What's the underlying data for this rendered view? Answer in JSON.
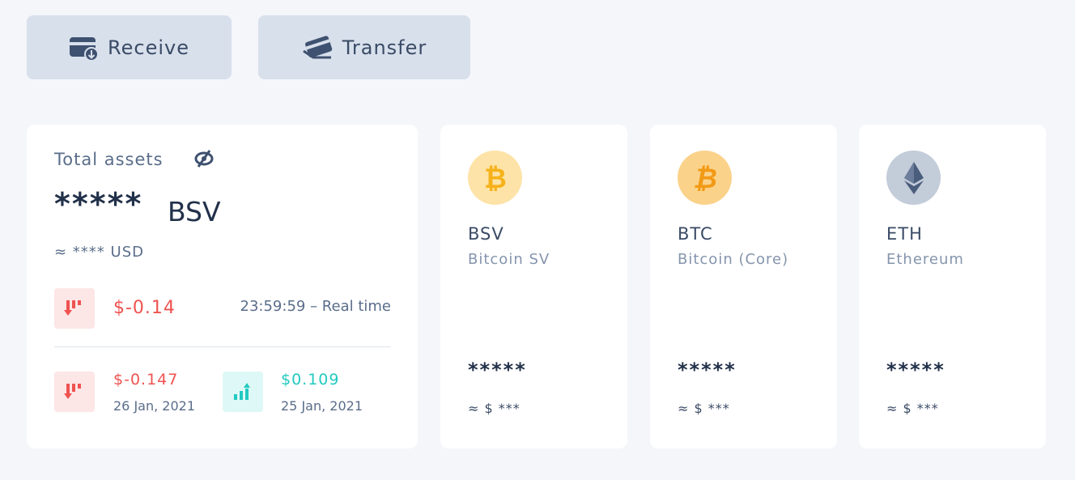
{
  "actions": {
    "receive_label": "Receive",
    "receive_icon": "wallet-receive-icon",
    "transfer_label": "Transfer",
    "transfer_icon": "card-transfer-icon"
  },
  "total": {
    "label": "Total assets",
    "visibility_icon": "eye-off-icon",
    "amount": "*****",
    "unit": "BSV",
    "usd": "≈ **** USD",
    "change": {
      "value": "$-0.14",
      "direction": "down",
      "time": "23:59:59 – Real time"
    },
    "history": [
      {
        "value": "$-0.147",
        "date": "26 Jan, 2021",
        "direction": "down"
      },
      {
        "value": "$0.109",
        "date": "25 Jan, 2021",
        "direction": "up"
      }
    ]
  },
  "coins": [
    {
      "symbol": "BSV",
      "name": "Bitcoin SV",
      "amount": "*****",
      "usd": "≈ $ ***",
      "logo": "bitcoin-icon",
      "logo_color": "#fde3a7"
    },
    {
      "symbol": "BTC",
      "name": "Bitcoin (Core)",
      "amount": "*****",
      "usd": "≈ $ ***",
      "logo": "bitcoin-icon",
      "logo_color": "#fbd28a"
    },
    {
      "symbol": "ETH",
      "name": "Ethereum",
      "amount": "*****",
      "usd": "≈ $ ***",
      "logo": "ethereum-icon",
      "logo_color": "#c3ccd9"
    }
  ],
  "colors": {
    "negative": "#ef5350",
    "positive": "#21c9c0",
    "background": "#f4f6fa",
    "button": "#d8e0ec"
  }
}
